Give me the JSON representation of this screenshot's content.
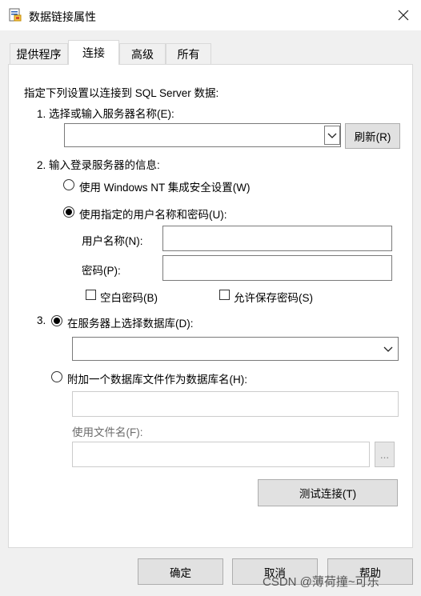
{
  "window": {
    "title": "数据链接属性"
  },
  "tabs": [
    {
      "label": "提供程序"
    },
    {
      "label": "连接"
    },
    {
      "label": "高级"
    },
    {
      "label": "所有"
    }
  ],
  "connection": {
    "intro": "指定下列设置以连接到 SQL Server 数据:",
    "step1_label": "1. 选择或输入服务器名称(E):",
    "server_value": "",
    "refresh_label": "刷新(R)",
    "step2_label": "2. 输入登录服务器的信息:",
    "auth_windows_label": "使用 Windows NT 集成安全设置(W)",
    "auth_sql_label": "使用指定的用户名称和密码(U):",
    "username_label": "用户名称(N):",
    "username_value": "",
    "password_label": "密码(P):",
    "password_value": "",
    "blank_password_label": "空白密码(B)",
    "save_password_label": "允许保存密码(S)",
    "step3_prefix": "3.",
    "select_db_label": "在服务器上选择数据库(D):",
    "database_value": "",
    "attach_db_label": "附加一个数据库文件作为数据库名(H):",
    "attach_name_value": "",
    "filename_label": "使用文件名(F):",
    "filename_value": "",
    "browse_label": "...",
    "test_label": "测试连接(T)"
  },
  "footer": {
    "ok_label": "确定",
    "cancel_label": "取消",
    "help_label": "帮助",
    "watermark": "CSDN @薄荷撞~可乐"
  }
}
